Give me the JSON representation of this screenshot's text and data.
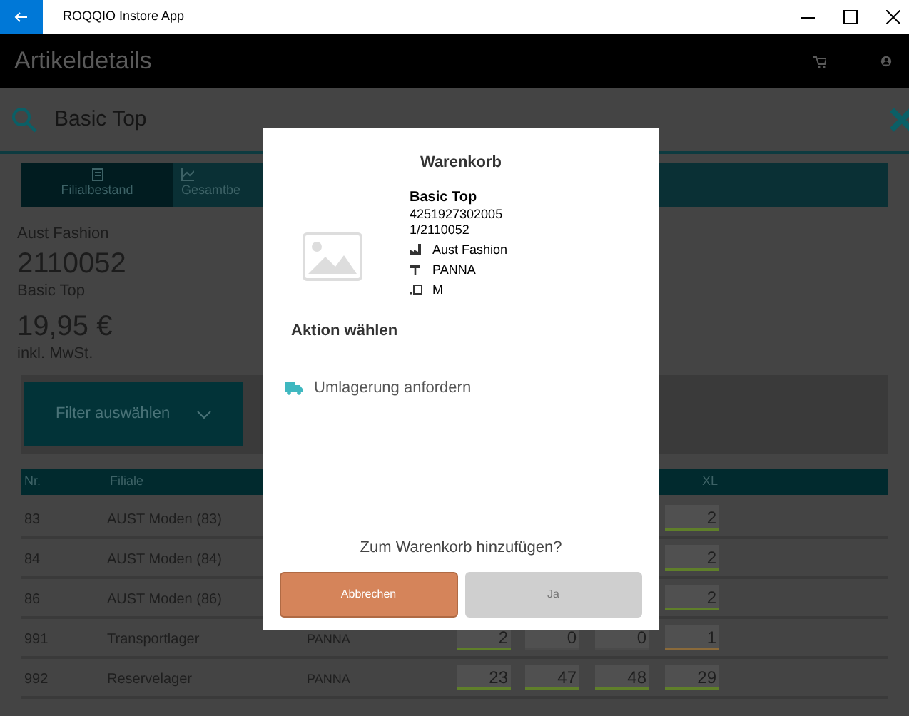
{
  "window": {
    "title": "ROQQIO Instore App"
  },
  "header": {
    "title": "Artikeldetails"
  },
  "search": {
    "value": "Basic Top"
  },
  "tabs": [
    {
      "label": "Filialbestand",
      "selected": true
    },
    {
      "label": "Gesamtbe",
      "selected": false
    }
  ],
  "article": {
    "brand": "Aust Fashion",
    "number": "2110052",
    "name": "Basic Top",
    "price": "19,95 €",
    "tax_note": "inkl. MwSt."
  },
  "filter": {
    "label": "Filter auswählen"
  },
  "table": {
    "columns": [
      "Nr.",
      "Filiale",
      null,
      null,
      null,
      null,
      "XL"
    ],
    "rows": [
      {
        "nr": "83",
        "branch": "AUST Moden (83)",
        "column_3": null,
        "cells": [
          null,
          null,
          null,
          {
            "value": "2",
            "color": "#5f7f2a"
          }
        ]
      },
      {
        "nr": "84",
        "branch": "AUST Moden (84)",
        "column_3": null,
        "cells": [
          null,
          null,
          null,
          {
            "value": "2",
            "color": "#5f7f2a"
          }
        ]
      },
      {
        "nr": "86",
        "branch": "AUST Moden (86)",
        "column_3": null,
        "cells": [
          null,
          null,
          null,
          {
            "value": "2",
            "color": "#5f7f2a"
          }
        ]
      },
      {
        "nr": "991",
        "branch": "Transportlager",
        "column_3": "PANNA",
        "cells": [
          {
            "value": "2",
            "color": "#5f7f2a"
          },
          {
            "value": "0",
            "color": "#4a4a4a"
          },
          {
            "value": "0",
            "color": "#4a4a4a"
          },
          {
            "value": "1",
            "color": "#8a6a3a"
          }
        ]
      },
      {
        "nr": "992",
        "branch": "Reservelager",
        "column_3": "PANNA",
        "cells": [
          {
            "value": "23",
            "color": "#5f7f2a"
          },
          {
            "value": "47",
            "color": "#5f7f2a"
          },
          {
            "value": "48",
            "color": "#5f7f2a"
          },
          {
            "value": "29",
            "color": "#5f7f2a"
          }
        ]
      }
    ]
  },
  "dialog": {
    "title": "Warenkorb",
    "product": {
      "name": "Basic Top",
      "ean": "4251927302005",
      "article_no": "1/2110052",
      "supplier": "Aust Fashion",
      "variant": "PANNA",
      "size": "M"
    },
    "section": "Aktion wählen",
    "action": "Umlagerung anfordern",
    "question": "Zum Warenkorb hinzufügen?",
    "buttons": [
      {
        "label": "Abbrechen",
        "kind": "cancel"
      },
      {
        "label": "Ja",
        "kind": "confirm"
      }
    ]
  }
}
